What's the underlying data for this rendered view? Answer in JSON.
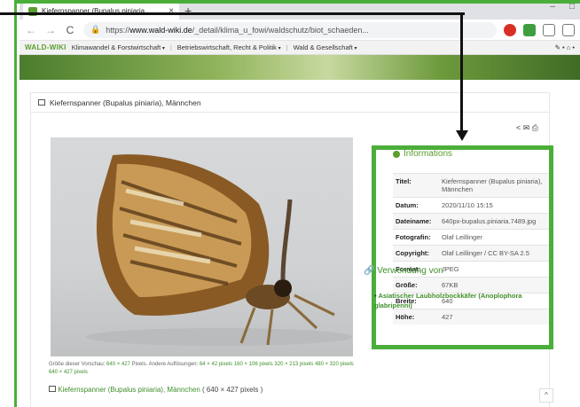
{
  "browser": {
    "tab_title": "Kiefernspanner (Bupalus piniaria",
    "tab_close": "×",
    "new_tab": "+",
    "window_controls": [
      "–",
      "□"
    ],
    "url_prefix": "https://",
    "url_domain": "www.wald-wiki.de",
    "url_path": "/_detail/klima_u_fowi/waldschutz/biot_schaeden...",
    "nav_back": "←",
    "nav_forward": "→",
    "nav_reload": "C"
  },
  "bookmarks": {
    "logo": "WALD-WIKI",
    "items": [
      "Klimawandel & Forstwirtschaft",
      "Betriebswirtschaft, Recht & Politik",
      "Wald & Gesellschaft"
    ],
    "tools": "✎ • ⌂ •"
  },
  "page": {
    "header_title": "Kiefernspanner (Bupalus piniaria), Männchen",
    "share_icons": "< ✉ ⎙",
    "caption_prefix": "Größe dieser Vorschau:",
    "caption_size": "640 × 427",
    "caption_mid": "Pixels. Andere Auflösungen:",
    "caption_links": [
      "64 × 42 pixels",
      "160 × 106 pixels",
      "320 × 213 pixels",
      "480 × 320 pixels",
      "640 × 427 pixels"
    ],
    "file_link": "Kiefernspanner (Bupalus piniaria), Männchen",
    "file_size": "( 640 × 427 pixels )"
  },
  "info": {
    "title": "Informations",
    "rows": [
      {
        "k": "Titel:",
        "v": "Kiefernspanner (Bupalus piniaria), Männchen"
      },
      {
        "k": "Datum:",
        "v": "2020/11/10 15:15"
      },
      {
        "k": "Dateiname:",
        "v": "640px-bupalus.piniaria.7489.jpg"
      },
      {
        "k": "Fotografin:",
        "v": "Olaf Leillinger"
      },
      {
        "k": "Copyright:",
        "v": "Olaf Leillinger / CC BY-SA 2.5"
      },
      {
        "k": "Format:",
        "v": "JPEG"
      },
      {
        "k": "Größe:",
        "v": "67KB"
      },
      {
        "k": "Breite:",
        "v": "640"
      },
      {
        "k": "Höhe:",
        "v": "427"
      }
    ]
  },
  "usage": {
    "title": "Verwendung von",
    "item": "Asiatischer Laubholzbockkäfer (Anoplophora glabripenni)"
  },
  "colors": {
    "brand": "#5a9e2f",
    "highlight": "#4cae3a",
    "arrow": "#111111"
  }
}
